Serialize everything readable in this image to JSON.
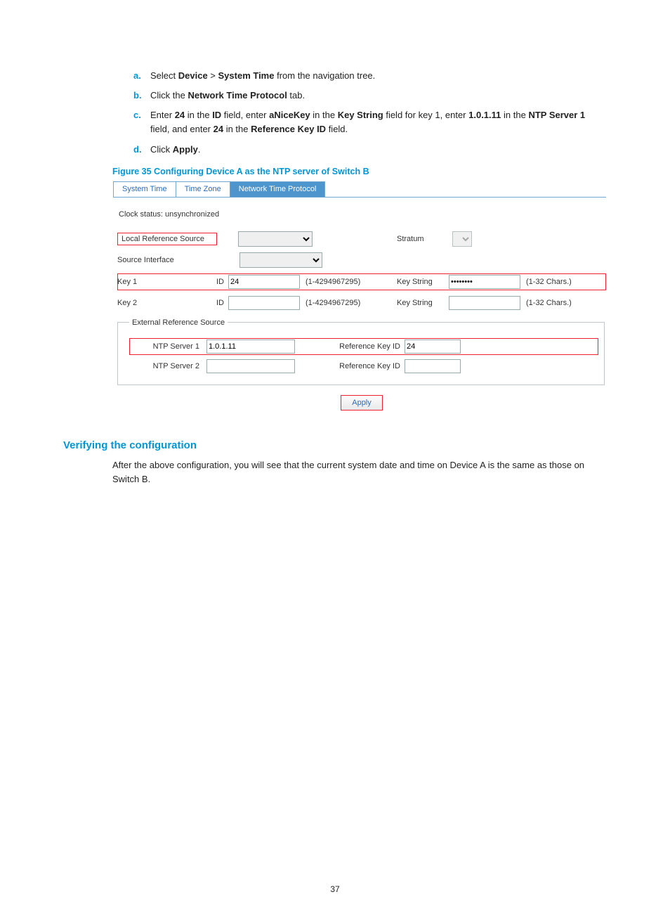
{
  "steps": {
    "a": {
      "marker": "a.",
      "pre": "Select ",
      "b1": "Device",
      "mid": " > ",
      "b2": "System Time",
      "post": " from the navigation tree."
    },
    "b": {
      "marker": "b.",
      "pre": "Click the ",
      "b1": "Network Time Protocol",
      "post": " tab."
    },
    "c": {
      "marker": "c.",
      "t1": "Enter ",
      "b1": "24",
      "t2": " in the ",
      "b2": "ID",
      "t3": " field, enter ",
      "b3": "aNiceKey",
      "t4": " in the ",
      "b4": "Key String",
      "t5": " field for key 1, enter ",
      "b5": "1.0.1.11",
      "t6": " in the ",
      "b6": "NTP Server 1",
      "t7": " field, and enter ",
      "b7": "24",
      "t8": " in the ",
      "b8": "Reference Key ID",
      "t9": " field."
    },
    "d": {
      "marker": "d.",
      "pre": "Click ",
      "b1": "Apply",
      "post": "."
    }
  },
  "figcap": "Figure 35 Configuring Device A as the NTP server of Switch B",
  "tabs": {
    "system_time": "System Time",
    "time_zone": "Time Zone",
    "ntp": "Network Time Protocol"
  },
  "panel": {
    "clock_status_label": "Clock status: unsynchronized",
    "local_ref_label": "Local Reference Source",
    "stratum_label": "Stratum",
    "src_if_label": "Source Interface",
    "key1_label": "Key 1",
    "key2_label": "Key 2",
    "id_label": "ID",
    "id_hint": "(1-4294967295)",
    "ks_label": "Key String",
    "ks_hint": "(1-32 Chars.)",
    "key1_id_value": "24",
    "key1_ks_value": "••••••••",
    "key2_id_value": "",
    "key2_ks_value": ""
  },
  "ext": {
    "legend": "External Reference Source",
    "srv1_label": "NTP Server 1",
    "srv2_label": "NTP Server 2",
    "ref_label": "Reference Key ID",
    "srv1_value": "1.0.1.11",
    "srv1_ref": "24",
    "srv2_value": "",
    "srv2_ref": "",
    "apply": "Apply"
  },
  "h2": "Verifying the configuration",
  "para": "After the above configuration, you will see that the current system date and time on Device A is the same as those on Switch B.",
  "pagenum": "37"
}
